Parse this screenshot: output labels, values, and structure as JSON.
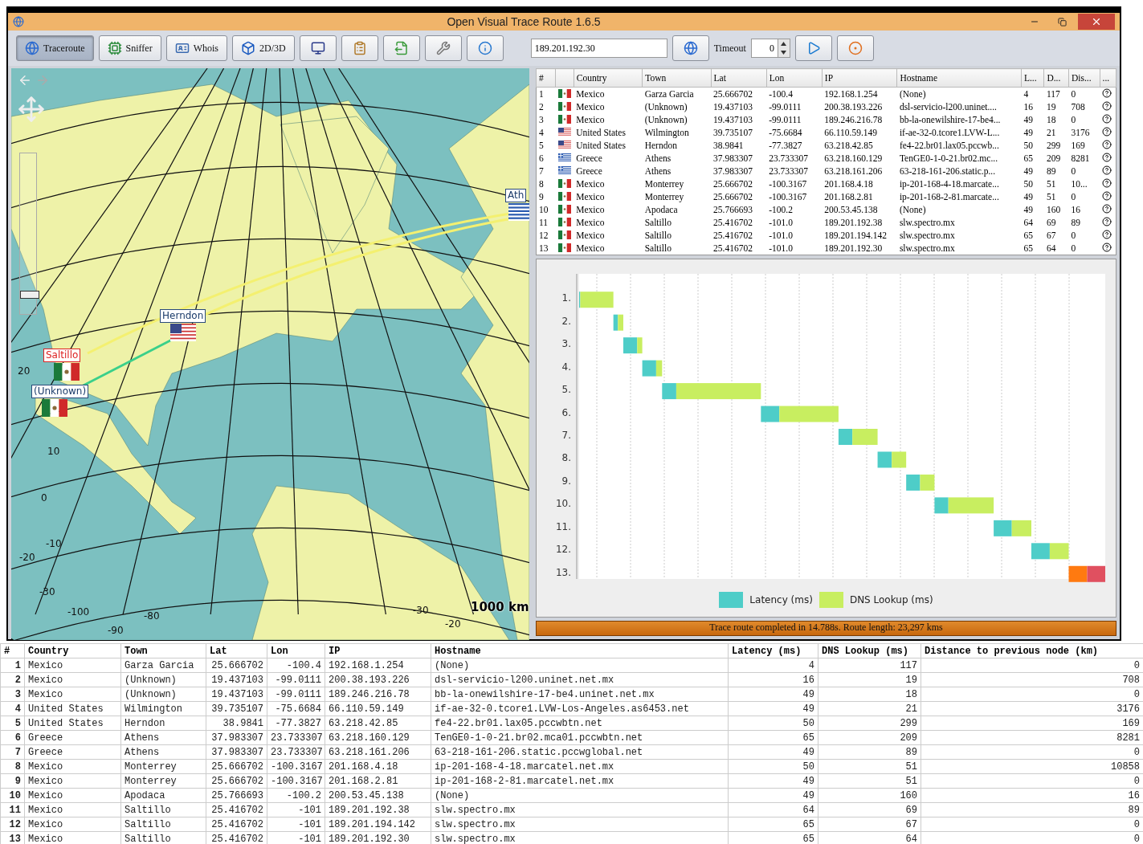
{
  "window": {
    "title": "Open Visual Trace Route 1.6.5"
  },
  "toolbar": {
    "buttons": [
      {
        "label": "Traceroute",
        "selected": true
      },
      {
        "label": "Sniffer",
        "selected": false
      },
      {
        "label": "Whois",
        "selected": false
      },
      {
        "label": "2D/3D",
        "selected": false
      }
    ],
    "address": {
      "value": "189.201.192.30"
    },
    "timeout": {
      "label": "Timeout",
      "value": "0"
    }
  },
  "map": {
    "zoom": {
      "level": 0.1
    },
    "scale": "1000 km",
    "markers": [
      {
        "label": "Herndon",
        "kind": "united_states",
        "destination": false
      },
      {
        "label": "Saltillo",
        "kind": "mexico",
        "destination": true
      },
      {
        "label": "(Unknown)",
        "kind": "mexico",
        "destination": false
      },
      {
        "label": "Ath",
        "kind": "greece",
        "destination": false
      }
    ],
    "grid_labels": [
      "20",
      "10",
      "0",
      "-10",
      "-20",
      "-30",
      "-100",
      "-80",
      "-90",
      "-30",
      "-20"
    ]
  },
  "hops_table": {
    "columns": [
      "#",
      "Country",
      "Town",
      "Lat",
      "Lon",
      "IP",
      "Hostname",
      "L...",
      "D...",
      "Dis...",
      "..."
    ],
    "rows": [
      {
        "n": "1",
        "kind": "mexico",
        "country": "Mexico",
        "town": "Garza Garcia",
        "lat": "25.666702",
        "lon": "-100.4",
        "ip": "192.168.1.254",
        "host": "(None)",
        "l": "4",
        "d": "117",
        "dis": "0"
      },
      {
        "n": "2",
        "kind": "mexico",
        "country": "Mexico",
        "town": "(Unknown)",
        "lat": "19.437103",
        "lon": "-99.0111",
        "ip": "200.38.193.226",
        "host": "dsl-servicio-l200.uninet....",
        "l": "16",
        "d": "19",
        "dis": "708"
      },
      {
        "n": "3",
        "kind": "mexico",
        "country": "Mexico",
        "town": "(Unknown)",
        "lat": "19.437103",
        "lon": "-99.0111",
        "ip": "189.246.216.78",
        "host": "bb-la-onewilshire-17-be4...",
        "l": "49",
        "d": "18",
        "dis": "0"
      },
      {
        "n": "4",
        "kind": "united_states",
        "country": "United States",
        "town": "Wilmington",
        "lat": "39.735107",
        "lon": "-75.6684",
        "ip": "66.110.59.149",
        "host": "if-ae-32-0.tcore1.LVW-L...",
        "l": "49",
        "d": "21",
        "dis": "3176"
      },
      {
        "n": "5",
        "kind": "united_states",
        "country": "United States",
        "town": "Herndon",
        "lat": "38.9841",
        "lon": "-77.3827",
        "ip": "63.218.42.85",
        "host": "fe4-22.br01.lax05.pccwb...",
        "l": "50",
        "d": "299",
        "dis": "169"
      },
      {
        "n": "6",
        "kind": "greece",
        "country": "Greece",
        "town": "Athens",
        "lat": "37.983307",
        "lon": "23.733307",
        "ip": "63.218.160.129",
        "host": "TenGE0-1-0-21.br02.mc...",
        "l": "65",
        "d": "209",
        "dis": "8281"
      },
      {
        "n": "7",
        "kind": "greece",
        "country": "Greece",
        "town": "Athens",
        "lat": "37.983307",
        "lon": "23.733307",
        "ip": "63.218.161.206",
        "host": "63-218-161-206.static.p...",
        "l": "49",
        "d": "89",
        "dis": "0"
      },
      {
        "n": "8",
        "kind": "mexico",
        "country": "Mexico",
        "town": "Monterrey",
        "lat": "25.666702",
        "lon": "-100.3167",
        "ip": "201.168.4.18",
        "host": "ip-201-168-4-18.marcate...",
        "l": "50",
        "d": "51",
        "dis": "10..."
      },
      {
        "n": "9",
        "kind": "mexico",
        "country": "Mexico",
        "town": "Monterrey",
        "lat": "25.666702",
        "lon": "-100.3167",
        "ip": "201.168.2.81",
        "host": "ip-201-168-2-81.marcate...",
        "l": "49",
        "d": "51",
        "dis": "0"
      },
      {
        "n": "10",
        "kind": "mexico",
        "country": "Mexico",
        "town": "Apodaca",
        "lat": "25.766693",
        "lon": "-100.2",
        "ip": "200.53.45.138",
        "host": "(None)",
        "l": "49",
        "d": "160",
        "dis": "16"
      },
      {
        "n": "11",
        "kind": "mexico",
        "country": "Mexico",
        "town": "Saltillo",
        "lat": "25.416702",
        "lon": "-101.0",
        "ip": "189.201.192.38",
        "host": "slw.spectro.mx",
        "l": "64",
        "d": "69",
        "dis": "89"
      },
      {
        "n": "12",
        "kind": "mexico",
        "country": "Mexico",
        "town": "Saltillo",
        "lat": "25.416702",
        "lon": "-101.0",
        "ip": "189.201.194.142",
        "host": "slw.spectro.mx",
        "l": "65",
        "d": "67",
        "dis": "0"
      },
      {
        "n": "13",
        "kind": "mexico",
        "country": "Mexico",
        "town": "Saltillo",
        "lat": "25.416702",
        "lon": "-101.0",
        "ip": "189.201.192.30",
        "host": "slw.spectro.mx",
        "l": "65",
        "d": "64",
        "dis": "0"
      }
    ]
  },
  "timeline": {
    "row_labels": [
      "1.",
      "2.",
      "3.",
      "4.",
      "5.",
      "6.",
      "7.",
      "8.",
      "9.",
      "10.",
      "11.",
      "12.",
      "13."
    ],
    "legend": [
      {
        "label": "Latency (ms)",
        "color": "#4ecdc8"
      },
      {
        "label": "DNS Lookup (ms)",
        "color": "#c8ee60"
      }
    ]
  },
  "status_bar": "Trace route completed in 14.788s. Route length: 23,297 kms",
  "export_table": {
    "columns": [
      "#",
      "Country",
      "Town",
      "Lat",
      "Lon",
      "IP",
      "Hostname",
      "Latency (ms)",
      "DNS Lookup (ms)",
      "Distance to previous node (km)"
    ],
    "rows": [
      [
        "1",
        "Mexico",
        "Garza Garcia",
        "25.666702",
        "-100.4",
        "192.168.1.254",
        "(None)",
        "4",
        "117",
        "0"
      ],
      [
        "2",
        "Mexico",
        "(Unknown)",
        "19.437103",
        "-99.0111",
        "200.38.193.226",
        "dsl-servicio-l200.uninet.net.mx",
        "16",
        "19",
        "708"
      ],
      [
        "3",
        "Mexico",
        "(Unknown)",
        "19.437103",
        "-99.0111",
        "189.246.216.78",
        "bb-la-onewilshire-17-be4.uninet.net.mx",
        "49",
        "18",
        "0"
      ],
      [
        "4",
        "United States",
        "Wilmington",
        "39.735107",
        "-75.6684",
        "66.110.59.149",
        "if-ae-32-0.tcore1.LVW-Los-Angeles.as6453.net",
        "49",
        "21",
        "3176"
      ],
      [
        "5",
        "United States",
        "Herndon",
        "38.9841",
        "-77.3827",
        "63.218.42.85",
        "fe4-22.br01.lax05.pccwbtn.net",
        "50",
        "299",
        "169"
      ],
      [
        "6",
        "Greece",
        "Athens",
        "37.983307",
        "23.733307",
        "63.218.160.129",
        "TenGE0-1-0-21.br02.mca01.pccwbtn.net",
        "65",
        "209",
        "8281"
      ],
      [
        "7",
        "Greece",
        "Athens",
        "37.983307",
        "23.733307",
        "63.218.161.206",
        "63-218-161-206.static.pccwglobal.net",
        "49",
        "89",
        "0"
      ],
      [
        "8",
        "Mexico",
        "Monterrey",
        "25.666702",
        "-100.3167",
        "201.168.4.18",
        "ip-201-168-4-18.marcatel.net.mx",
        "50",
        "51",
        "10858"
      ],
      [
        "9",
        "Mexico",
        "Monterrey",
        "25.666702",
        "-100.3167",
        "201.168.2.81",
        "ip-201-168-2-81.marcatel.net.mx",
        "49",
        "51",
        "0"
      ],
      [
        "10",
        "Mexico",
        "Apodaca",
        "25.766693",
        "-100.2",
        "200.53.45.138",
        "(None)",
        "49",
        "160",
        "16"
      ],
      [
        "11",
        "Mexico",
        "Saltillo",
        "25.416702",
        "-101",
        "189.201.192.38",
        "slw.spectro.mx",
        "64",
        "69",
        "89"
      ],
      [
        "12",
        "Mexico",
        "Saltillo",
        "25.416702",
        "-101",
        "189.201.194.142",
        "slw.spectro.mx",
        "65",
        "67",
        "0"
      ],
      [
        "13",
        "Mexico",
        "Saltillo",
        "25.416702",
        "-101",
        "189.201.192.30",
        "slw.spectro.mx",
        "65",
        "64",
        "0"
      ]
    ]
  }
}
